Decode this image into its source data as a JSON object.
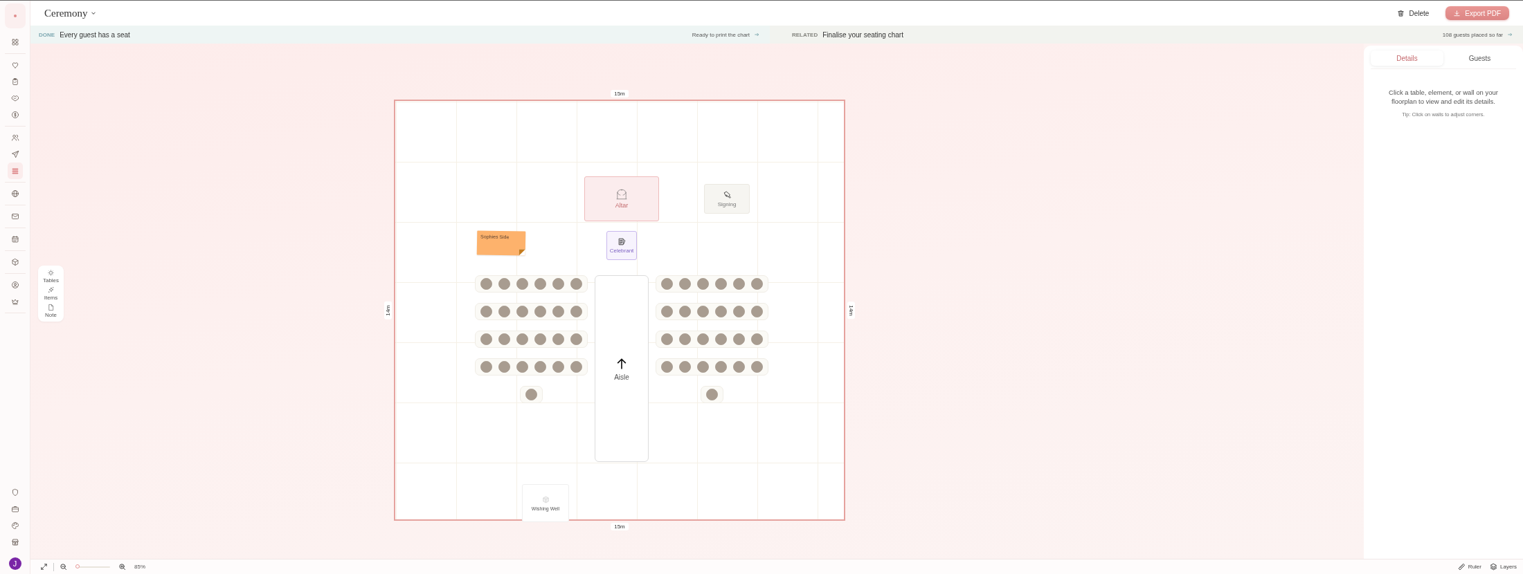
{
  "sidebar": {
    "groups": [
      [
        {
          "selected": false
        }
      ],
      [
        {
          "selected": false
        },
        {
          "selected": false
        },
        {
          "selected": false
        },
        {
          "selected": false
        }
      ],
      [
        {
          "selected": false
        },
        {
          "selected": false
        },
        {
          "selected": true
        }
      ],
      [
        {
          "selected": false
        }
      ],
      [
        {
          "selected": false
        }
      ],
      [
        {
          "selected": false
        }
      ],
      [
        {
          "selected": false
        }
      ],
      [
        {
          "selected": false
        },
        {
          "selected": false
        }
      ]
    ],
    "bottom": [
      {
        "selected": false
      },
      {
        "selected": false
      },
      {
        "selected": false
      },
      {
        "selected": false
      }
    ],
    "avatar": "J"
  },
  "header": {
    "title": "Ceremony",
    "delete_label": "Delete",
    "export_label": "Export PDF"
  },
  "banners": [
    {
      "kind": "done",
      "tag": "DONE",
      "title": "Every guest has a seat",
      "link": "Ready to print the chart"
    },
    {
      "kind": "related",
      "tag": "RELATED",
      "title": "Finalise your seating chart",
      "link": "108 guests placed so far"
    }
  ],
  "tools": [
    {
      "label": "Tables"
    },
    {
      "label": "Items"
    },
    {
      "label": "Note"
    }
  ],
  "floorplan": {
    "top_label": "15m",
    "bottom_label": "15m",
    "left_label": "14m",
    "right_label": "14m",
    "elements": [
      {
        "kind": "altar",
        "label": "Altar"
      },
      {
        "kind": "signing",
        "label": "Signing"
      },
      {
        "kind": "note",
        "label": "Sophies Side"
      },
      {
        "kind": "celebrant",
        "label": "Celebrant"
      },
      {
        "kind": "aisle",
        "label": "Aisle"
      },
      {
        "kind": "wishing_well",
        "label": "Wishing Well"
      }
    ],
    "seating": [
      {
        "rows": [
          {
            "seats": [
              {
                "occupied": true
              },
              {
                "occupied": true
              },
              {
                "occupied": true
              },
              {
                "occupied": true
              },
              {
                "occupied": true
              },
              {
                "occupied": true
              }
            ]
          },
          {
            "seats": [
              {
                "occupied": true
              },
              {
                "occupied": true
              },
              {
                "occupied": true
              },
              {
                "occupied": true
              },
              {
                "occupied": true
              },
              {
                "occupied": true
              }
            ]
          },
          {
            "seats": [
              {
                "occupied": true
              },
              {
                "occupied": true
              },
              {
                "occupied": true
              },
              {
                "occupied": true
              },
              {
                "occupied": true
              },
              {
                "occupied": true
              }
            ]
          },
          {
            "seats": [
              {
                "occupied": true
              },
              {
                "occupied": true
              },
              {
                "occupied": true
              },
              {
                "occupied": true
              },
              {
                "occupied": true
              },
              {
                "occupied": true
              }
            ]
          },
          {
            "seats": [
              {
                "occupied": true
              }
            ]
          }
        ]
      },
      {
        "rows": [
          {
            "seats": [
              {
                "occupied": true
              },
              {
                "occupied": true
              },
              {
                "occupied": true
              },
              {
                "occupied": true
              },
              {
                "occupied": true
              },
              {
                "occupied": true
              }
            ]
          },
          {
            "seats": [
              {
                "occupied": true
              },
              {
                "occupied": true
              },
              {
                "occupied": true
              },
              {
                "occupied": true
              },
              {
                "occupied": true
              },
              {
                "occupied": true
              }
            ]
          },
          {
            "seats": [
              {
                "occupied": true
              },
              {
                "occupied": true
              },
              {
                "occupied": true
              },
              {
                "occupied": true
              },
              {
                "occupied": true
              },
              {
                "occupied": true
              }
            ]
          },
          {
            "seats": [
              {
                "occupied": true
              },
              {
                "occupied": true
              },
              {
                "occupied": true
              },
              {
                "occupied": true
              },
              {
                "occupied": true
              },
              {
                "occupied": true
              }
            ]
          },
          {
            "seats": [
              {
                "occupied": true
              }
            ]
          }
        ]
      }
    ]
  },
  "panel": {
    "tabs": [
      {
        "label": "Details",
        "selected": true
      },
      {
        "label": "Guests",
        "selected": false
      }
    ],
    "message": "Click a table, element, or wall on your floorplan to view and edit its details.",
    "tip": "Tip: Click on walls to adjust corners."
  },
  "bottom_bar": {
    "zoom": {
      "level": 0.05,
      "reading": "85%"
    },
    "ruler_label": "Ruler",
    "layers_label": "Layers"
  }
}
